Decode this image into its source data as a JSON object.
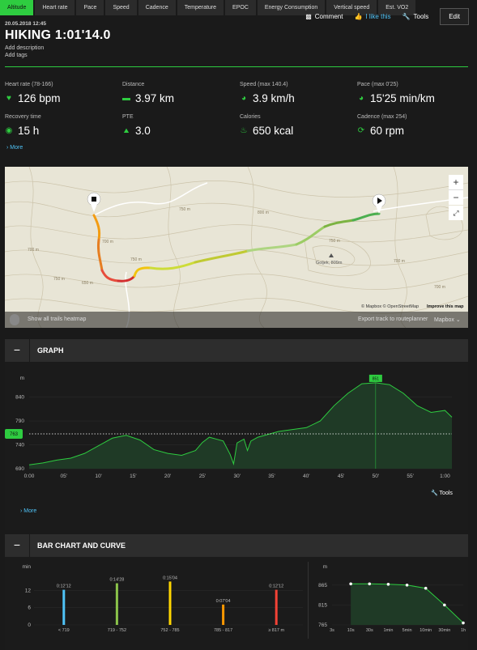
{
  "header": {
    "comment": "Comment",
    "like": "I like this",
    "tools": "Tools",
    "edit": "Edit",
    "date": "20.05.2018 12:45",
    "title": "HIKING 1:01'14.0",
    "add_description": "Add description",
    "add_tags": "Add tags"
  },
  "stats": [
    {
      "label": "Heart rate (78-166)",
      "value": "126 bpm",
      "icon": "heart-icon"
    },
    {
      "label": "Distance",
      "value": "3.97 km",
      "icon": "distance-icon"
    },
    {
      "label": "Speed (max 140.4)",
      "value": "3.9 km/h",
      "icon": "speed-icon"
    },
    {
      "label": "Pace (max 0'25)",
      "value": "15'25 min/km",
      "icon": "pace-icon"
    },
    {
      "label": "Recovery time",
      "value": "15 h",
      "icon": "recovery-icon"
    },
    {
      "label": "PTE",
      "value": "3.0",
      "icon": "pte-icon"
    },
    {
      "label": "Calories",
      "value": "650 kcal",
      "icon": "flame-icon"
    },
    {
      "label": "Cadence (max 254)",
      "value": "60 rpm",
      "icon": "cadence-icon"
    }
  ],
  "more": "More",
  "map": {
    "heatmap": "Show all trails heatmap",
    "export": "Export track to routeplanner",
    "style": "Mapbox",
    "attribution": "© Mapbox © OpenStreetMap",
    "improve": "Improve this map",
    "peak": "Goljek, 809m",
    "contour_labels": [
      "750 m",
      "800 m",
      "700 m",
      "700 m",
      "750 m",
      "650 m",
      "750 m",
      "700 m",
      "750 m",
      "700 m"
    ],
    "zoom_in": "+",
    "zoom_out": "−"
  },
  "graph": {
    "title": "GRAPH",
    "collapse": "−",
    "unit": "m",
    "current": "763",
    "max_label": "851",
    "tools": "Tools",
    "more": "More",
    "tabs": [
      "Altitude",
      "Heart rate",
      "Pace",
      "Speed",
      "Cadence",
      "Temperature",
      "EPOC",
      "Energy Consumption",
      "Vertical speed",
      "Est. VO2"
    ]
  },
  "bars": {
    "title": "BAR CHART AND CURVE",
    "collapse": "−"
  },
  "chart_data": [
    {
      "type": "area",
      "title": "",
      "ylabel": "m",
      "xlabel": "",
      "ylim": [
        690,
        880
      ],
      "yticks": [
        690,
        740,
        790,
        840
      ],
      "x_ticks": [
        "0:00",
        "05'",
        "10'",
        "15'",
        "20'",
        "25'",
        "30'",
        "35'",
        "40'",
        "45'",
        "50'",
        "55'",
        "1:00"
      ],
      "x": [
        0,
        2,
        4,
        6,
        8,
        10,
        12,
        14,
        16,
        18,
        20,
        22,
        24,
        25,
        26,
        27,
        28,
        29,
        29.5,
        30,
        31,
        31.5,
        32,
        33,
        34,
        36,
        38,
        40,
        42,
        44,
        46,
        48,
        50,
        52,
        54,
        56,
        58,
        60,
        61
      ],
      "y": [
        698,
        702,
        708,
        712,
        722,
        738,
        754,
        760,
        750,
        730,
        722,
        718,
        728,
        745,
        756,
        752,
        748,
        720,
        700,
        744,
        752,
        728,
        748,
        756,
        760,
        768,
        772,
        776,
        790,
        822,
        848,
        868,
        870,
        866,
        848,
        822,
        808,
        812,
        798
      ],
      "reference_line": 763,
      "grid": true
    },
    {
      "type": "bar",
      "title": "",
      "ylabel": "min",
      "ylim": [
        0,
        18
      ],
      "yticks": [
        0,
        6,
        12
      ],
      "categories": [
        "< 719",
        "719 - 752",
        "752 - 785",
        "785 - 817",
        "≥ 817 m"
      ],
      "values": [
        12.2,
        14.47,
        15.07,
        7.07,
        12.2
      ],
      "data_labels": [
        "0:12'12",
        "0:14'28",
        "0:15'04",
        "0:07'04",
        "0:12'12"
      ],
      "colors": [
        "#4fc3f7",
        "#8bc34a",
        "#ffd600",
        "#ff9800",
        "#f44336"
      ]
    },
    {
      "type": "line",
      "title": "",
      "ylabel": "m",
      "ylim": [
        765,
        895
      ],
      "yticks": [
        765,
        815,
        865
      ],
      "categories": [
        "3s",
        "10s",
        "30s",
        "1min",
        "5min",
        "10min",
        "30min",
        "1h"
      ],
      "values": [
        null,
        868,
        868,
        867,
        865,
        857,
        815,
        770
      ]
    }
  ]
}
